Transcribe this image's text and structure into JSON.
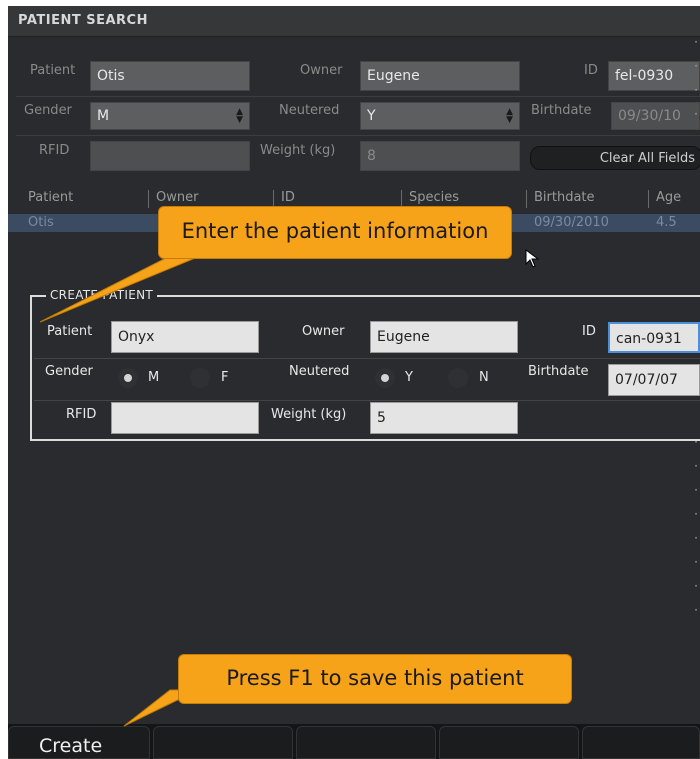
{
  "window": {
    "title": "PATIENT SEARCH"
  },
  "search": {
    "patient_label": "Patient",
    "patient_value": "Otis",
    "owner_label": "Owner",
    "owner_value": "Eugene",
    "id_label": "ID",
    "id_value": "fel-0930",
    "gender_label": "Gender",
    "gender_value": "M",
    "neutered_label": "Neutered",
    "neutered_value": "Y",
    "birthdate_label": "Birthdate",
    "birthdate_value": "09/30/10",
    "rfid_label": "RFID",
    "rfid_value": "",
    "weight_label": "Weight (kg)",
    "weight_value": "8",
    "clear_label": "Clear All Fields"
  },
  "results": {
    "columns": [
      "Patient",
      "Owner",
      "ID",
      "Species",
      "Birthdate",
      "Age"
    ],
    "rows": [
      {
        "patient": "Otis",
        "birthdate": "09/30/2010",
        "age": "4.5"
      }
    ]
  },
  "create": {
    "legend": "CREATE PATIENT",
    "patient_label": "Patient",
    "patient_value": "Onyx",
    "owner_label": "Owner",
    "owner_value": "Eugene",
    "id_label": "ID",
    "id_value": "can-0931",
    "gender_label": "Gender",
    "gender_m": "M",
    "gender_f": "F",
    "gender_selected": "M",
    "neutered_label": "Neutered",
    "neutered_y": "Y",
    "neutered_n": "N",
    "neutered_selected": "Y",
    "birthdate_label": "Birthdate",
    "birthdate_value": "07/07/07",
    "rfid_label": "RFID",
    "rfid_value": "",
    "weight_label": "Weight (kg)",
    "weight_value": "5"
  },
  "callouts": {
    "enter_info": "Enter the patient information",
    "press_f1": "Press F1 to save this patient"
  },
  "toolbar": {
    "create_label": "Create"
  },
  "colors": {
    "callout": "#f7a319",
    "selection": "#3a4b62",
    "focus": "#4a8fd8"
  }
}
